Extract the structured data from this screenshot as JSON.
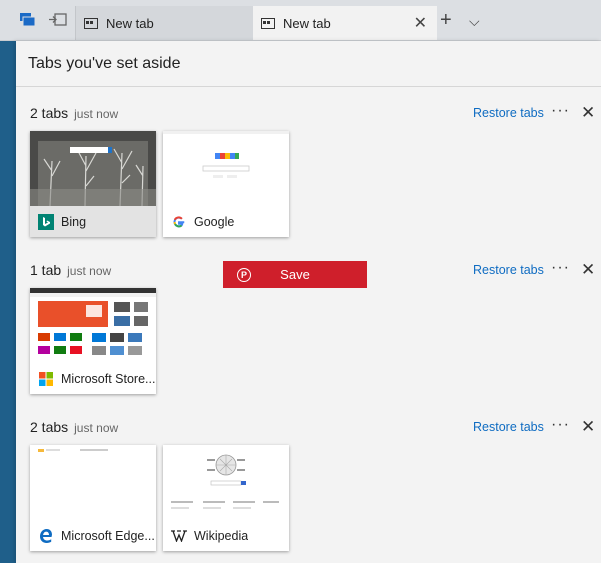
{
  "tabbar": {
    "inactive_tab": {
      "title": "New tab"
    },
    "active_tab": {
      "title": "New tab",
      "close": "✕"
    },
    "new_tab": "+",
    "more": "⌵"
  },
  "panel": {
    "title": "Tabs you've set aside",
    "groups": [
      {
        "count": "2 tabs",
        "time": "just now",
        "restore": "Restore tabs",
        "dots": "···",
        "close": "✕",
        "tabs": [
          {
            "name": "Bing",
            "icon": "bing-icon"
          },
          {
            "name": "Google",
            "icon": "google-icon"
          }
        ]
      },
      {
        "count": "1 tab",
        "time": "just now",
        "restore": "Restore tabs",
        "dots": "···",
        "close": "✕",
        "tabs": [
          {
            "name": "Microsoft Store...",
            "icon": "microsoft-logo-icon"
          }
        ]
      },
      {
        "count": "2 tabs",
        "time": "just now",
        "restore": "Restore tabs",
        "dots": "···",
        "close": "✕",
        "tabs": [
          {
            "name": "Microsoft Edge...",
            "icon": "edge-icon"
          },
          {
            "name": "Wikipedia",
            "icon": "wikipedia-icon"
          }
        ]
      }
    ]
  },
  "save_button": {
    "label": "Save",
    "icon": "pinterest-icon"
  },
  "colors": {
    "accent": "#0f6cc2",
    "save": "#cf1f2b"
  }
}
